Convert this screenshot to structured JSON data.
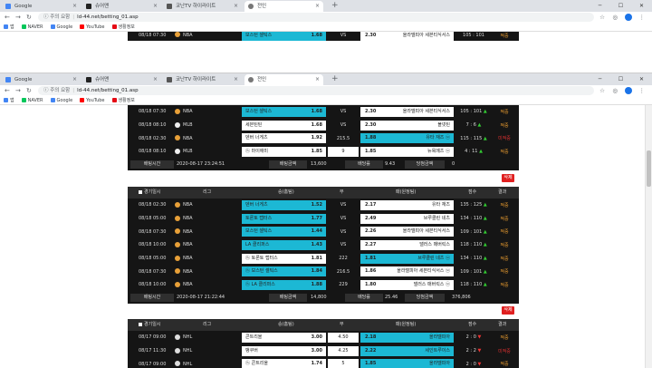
{
  "browser_top": {
    "tabs": [
      {
        "label": "Google",
        "icon": "google-favicon",
        "color": "#4285f4"
      },
      {
        "label": "슈어맨",
        "icon": "x-favicon",
        "color": "#222222"
      },
      {
        "label": "코난TV 하이라이트",
        "icon": "tv-favicon",
        "color": "#555555"
      },
      {
        "label": "전인",
        "icon": "globe-favicon",
        "color": "#777777",
        "active": true
      }
    ],
    "url_warning": "ⓘ 주의 요함",
    "url": "ld-44.net/betting_01.asp",
    "bookmarks": [
      {
        "label": "앱",
        "icon": "apps-icon",
        "color": "#4285f4"
      },
      {
        "label": "NAVER",
        "icon": "naver-icon",
        "color": "#03c75a"
      },
      {
        "label": "Google",
        "icon": "google-icon",
        "color": "#4285f4"
      },
      {
        "label": "YouTube",
        "icon": "youtube-icon",
        "color": "#ff0000"
      },
      {
        "label": "생활정보",
        "icon": "netflix-icon",
        "color": "#e50914"
      }
    ]
  },
  "browser_bottom": {
    "tabs": [
      {
        "label": "Google",
        "icon": "google-favicon",
        "color": "#4285f4"
      },
      {
        "label": "슈어맨",
        "icon": "x-favicon",
        "color": "#222222"
      },
      {
        "label": "코난TV 하이라이트",
        "icon": "tv-favicon",
        "color": "#555555"
      },
      {
        "label": "전인",
        "icon": "globe-favicon",
        "color": "#777777",
        "active": true
      }
    ],
    "url_warning": "ⓘ 주의 요함",
    "url": "ld-44.net/betting_01.asp",
    "bookmarks": [
      {
        "label": "앱",
        "icon": "apps-icon",
        "color": "#4285f4"
      },
      {
        "label": "NAVER",
        "icon": "naver-icon",
        "color": "#03c75a"
      },
      {
        "label": "Google",
        "icon": "google-icon",
        "color": "#4285f4"
      },
      {
        "label": "YouTube",
        "icon": "youtube-icon",
        "color": "#ff0000"
      },
      {
        "label": "생활정보",
        "icon": "netflix-icon",
        "color": "#e50914"
      }
    ]
  },
  "top_peek_row": {
    "time": "08/18 07:30",
    "league": "NBA",
    "home": "보스턴 셀틱스",
    "home_odd": "1.68",
    "mid": "VS",
    "away_odd": "2.30",
    "away": "올라델피아 세븐티식서스",
    "score": "105 : 101",
    "result": "적중"
  },
  "slip1": {
    "rows": [
      {
        "time": "08/18 07:30",
        "league": "NBA",
        "sport": "basketball",
        "home": "보스턴 셀틱스",
        "home_odd": "1.68",
        "home_sel": true,
        "mid": "VS",
        "mid_box": false,
        "away_odd": "2.30",
        "away": "올라델피아 세븐티식서스",
        "away_sel": false,
        "score": "105 : 101",
        "score_dot": "▲",
        "result": "적중"
      },
      {
        "time": "08/18 08:10",
        "league": "MLB",
        "sport": "baseball",
        "home": "세븐틴틴",
        "home_odd": "1.68",
        "home_sel": false,
        "mid": "VS",
        "mid_box": false,
        "away_odd": "2.30",
        "away": "볼넷틴",
        "away_sel": false,
        "score": "7 : 6",
        "score_dot": "▲",
        "result": "적중"
      },
      {
        "time": "08/18 02:30",
        "league": "NBA",
        "sport": "basketball",
        "home": "덴버 너게츠",
        "home_odd": "1.92",
        "home_sel": false,
        "mid": "215.5",
        "mid_box": false,
        "away_odd": "1.88",
        "away": "유타 재즈 ⓤ",
        "away_sel": true,
        "score": "115 : 115",
        "score_dot": "▲",
        "result": "미적중"
      },
      {
        "time": "08/18 08:10",
        "league": "MLB",
        "sport": "baseball",
        "home": "ⓗ 마이애미",
        "home_odd": "1.85",
        "home_sel": false,
        "mid": "9",
        "mid_box": true,
        "away_odd": "1.85",
        "away": "뉴욕메츠 ⓤ",
        "away_sel": false,
        "score": "4 : 11",
        "score_dot": "▲",
        "result": "적중"
      }
    ],
    "summary": {
      "time_label": "배팅시간",
      "time": "2020-08-17 23:24:51",
      "amount_label": "배팅금액",
      "amount": "13,600",
      "odds_label": "배당률",
      "odds": "9.43",
      "win_label": "당첨금액",
      "win": "0"
    },
    "delete_label": "삭제"
  },
  "slip2": {
    "headers": {
      "time": "경기일시",
      "league": "리그",
      "home": "승(홈팀)",
      "mid": "무",
      "away": "패(원정팀)",
      "score": "점수",
      "result": "결과"
    },
    "rows": [
      {
        "time": "08/18 02:30",
        "league": "NBA",
        "sport": "basketball",
        "home": "덴버 너게츠",
        "home_odd": "1.52",
        "home_sel": true,
        "mid": "VS",
        "mid_box": false,
        "away_odd": "2.17",
        "away": "유타 재즈",
        "away_sel": false,
        "score": "135 : 125",
        "score_dot": "▲",
        "result": "적중"
      },
      {
        "time": "08/18 05:00",
        "league": "NBA",
        "sport": "basketball",
        "home": "토론토 랩터스",
        "home_odd": "1.77",
        "home_sel": true,
        "mid": "VS",
        "mid_box": false,
        "away_odd": "2.49",
        "away": "브루클린 네츠",
        "away_sel": false,
        "score": "134 : 110",
        "score_dot": "▲",
        "result": "적중"
      },
      {
        "time": "08/18 07:30",
        "league": "NBA",
        "sport": "basketball",
        "home": "보스턴 셀틱스",
        "home_odd": "1.44",
        "home_sel": true,
        "mid": "VS",
        "mid_box": false,
        "away_odd": "2.26",
        "away": "올라델피아 세븐티식서스",
        "away_sel": false,
        "score": "109 : 101",
        "score_dot": "▲",
        "result": "적중"
      },
      {
        "time": "08/18 10:00",
        "league": "NBA",
        "sport": "basketball",
        "home": "LA 클리퍼스",
        "home_odd": "1.43",
        "home_sel": true,
        "mid": "VS",
        "mid_box": false,
        "away_odd": "2.27",
        "away": "댈러스 매버릭스",
        "away_sel": false,
        "score": "118 : 110",
        "score_dot": "▲",
        "result": "적중"
      },
      {
        "time": "08/18 05:00",
        "league": "NBA",
        "sport": "basketball",
        "home": "ⓗ 토론토 랩터스",
        "home_odd": "1.81",
        "home_sel": false,
        "mid": "222",
        "mid_box": false,
        "away_odd": "1.81",
        "away": "브루클린 네츠 ⓤ",
        "away_sel": true,
        "score": "134 : 110",
        "score_dot": "▲",
        "result": "적중"
      },
      {
        "time": "08/18 07:30",
        "league": "NBA",
        "sport": "basketball",
        "home": "ⓗ 보스턴 셀틱스",
        "home_odd": "1.84",
        "home_sel": true,
        "mid": "216.5",
        "mid_box": false,
        "away_odd": "1.86",
        "away": "올라델피아 세븐티식서스 ⓤ",
        "away_sel": false,
        "score": "109 : 101",
        "score_dot": "▲",
        "result": "적중"
      },
      {
        "time": "08/18 10:00",
        "league": "NBA",
        "sport": "basketball",
        "home": "ⓗ LA 클리퍼스",
        "home_odd": "1.88",
        "home_sel": true,
        "mid": "229",
        "mid_box": false,
        "away_odd": "1.80",
        "away": "댈러스 매버릭스 ⓤ",
        "away_sel": false,
        "score": "118 : 110",
        "score_dot": "▲",
        "result": "적중"
      }
    ],
    "summary": {
      "time_label": "배팅시간",
      "time": "2020-08-17 21:22:44",
      "amount_label": "배팅금액",
      "amount": "14,800",
      "odds_label": "배당률",
      "odds": "25.46",
      "win_label": "당첨금액",
      "win": "376,806"
    },
    "delete_label": "삭제"
  },
  "slip3": {
    "headers": {
      "time": "경기일시",
      "league": "리그",
      "home": "승(홈팀)",
      "mid": "무",
      "away": "패(원정팀)",
      "score": "점수",
      "result": "결과"
    },
    "rows": [
      {
        "time": "08/17 09:00",
        "league": "NHL",
        "sport": "hockey",
        "home": "콘트리올",
        "home_odd": "3.00",
        "home_sel": false,
        "mid": "4.50",
        "mid_box": true,
        "away_odd": "2.18",
        "away": "올라델피아",
        "away_sel": true,
        "score": "2 : 0",
        "score_dot": "▼",
        "result": "적중"
      },
      {
        "time": "08/17 11:30",
        "league": "NHL",
        "sport": "hockey",
        "home": "뱅쿠버",
        "home_odd": "3.00",
        "home_sel": false,
        "mid": "4.25",
        "mid_box": true,
        "away_odd": "2.22",
        "away": "세인트루이스",
        "away_sel": true,
        "score": "2 : 2",
        "score_dot": "▼",
        "result": "미적중"
      },
      {
        "time": "08/17 09:00",
        "league": "NHL",
        "sport": "hockey",
        "home": "ⓗ 콘트리올",
        "home_odd": "1.74",
        "home_sel": false,
        "mid": "5",
        "mid_box": true,
        "away_odd": "1.85",
        "away": "올라델피아",
        "away_sel": true,
        "score": "2 : 0",
        "score_dot": "▼",
        "result": "적중"
      }
    ]
  },
  "colors": {
    "selected": "#1cb8d4",
    "panel": "#151515",
    "win": "#f0a030",
    "lose": "#e03030",
    "delete": "#e02020"
  }
}
